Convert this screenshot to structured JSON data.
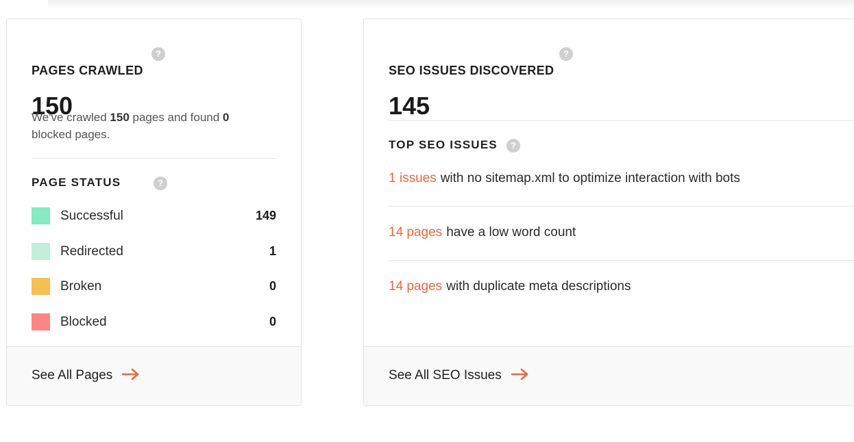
{
  "pages_card": {
    "title": "PAGES CRAWLED",
    "help_icon": "question-icon",
    "count": "150",
    "desc_prefix": "We've crawled ",
    "desc_pages": "150",
    "desc_middle": " pages and found ",
    "desc_blocked": "0",
    "desc_suffix": " blocked pages.",
    "status_title": "PAGE STATUS",
    "statuses": [
      {
        "label": "Successful",
        "count": "149",
        "color": "#86ebc2"
      },
      {
        "label": "Redirected",
        "count": "1",
        "color": "#c3eedb"
      },
      {
        "label": "Broken",
        "count": "0",
        "color": "#f6bf57"
      },
      {
        "label": "Blocked",
        "count": "0",
        "color": "#fc8686"
      }
    ],
    "footer_link": "See All Pages"
  },
  "seo_card": {
    "title": "SEO ISSUES DISCOVERED",
    "help_icon": "question-icon",
    "count": "145",
    "top_title": "TOP SEO ISSUES",
    "issues": [
      {
        "link": "1 issues",
        "text": "with no sitemap.xml to optimize interaction with bots"
      },
      {
        "link": "14 pages",
        "text": "have a low word count"
      },
      {
        "link": "14 pages",
        "text": "with duplicate meta descriptions"
      }
    ],
    "footer_link": "See All SEO Issues"
  },
  "colors": {
    "accent": "#e8693f",
    "help_icon": "#cfcfcf"
  }
}
